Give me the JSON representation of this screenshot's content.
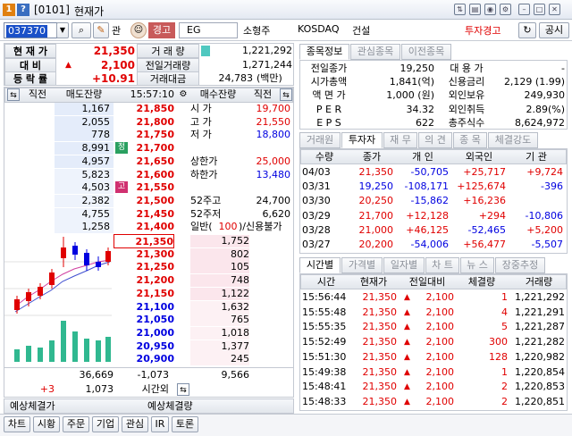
{
  "window": {
    "badge1": "1",
    "badge2": "?",
    "code_title": "[0101]",
    "title": "현재가"
  },
  "toolbar": {
    "code": "037370",
    "kwan": "관",
    "warn": "경고",
    "eg": "EG",
    "company": "소형주",
    "market": "KOSDAQ",
    "sector": "건설",
    "invest_warn": "투자경고",
    "share": "공시"
  },
  "summary": {
    "price_label": "현 재 가",
    "price": "21,350",
    "change_label": "대 비",
    "change_arrow": "▲",
    "change": "2,100",
    "rate_label": "등 락 률",
    "rate": "+10.91",
    "vol_label": "거 래 량",
    "vol": "1,221,292",
    "prev_vol_label": "전일거래량",
    "prev_vol": "1,271,244",
    "amount_label": "거래대금",
    "amount": "24,783",
    "amount_unit": "(백만)"
  },
  "ob": {
    "h_prev": "직전",
    "h_ask": "매도잔량",
    "time": "15:57:10",
    "h_bid": "매수잔량",
    "h_prev2": "직전",
    "asks": [
      {
        "q": "1,167",
        "p": "21,850"
      },
      {
        "q": "2,055",
        "p": "21,800"
      },
      {
        "q": "778",
        "p": "21,750"
      },
      {
        "q": "8,991",
        "p": "21,700",
        "tag": "정"
      },
      {
        "q": "4,957",
        "p": "21,650"
      },
      {
        "q": "5,823",
        "p": "21,600"
      },
      {
        "q": "4,503",
        "p": "21,550",
        "tag": "고"
      },
      {
        "q": "2,382",
        "p": "21,500"
      },
      {
        "q": "4,755",
        "p": "21,450"
      },
      {
        "q": "1,258",
        "p": "21,400"
      }
    ],
    "bids": [
      {
        "p": "21,350",
        "q": "1,752"
      },
      {
        "p": "21,300",
        "q": "802"
      },
      {
        "p": "21,250",
        "q": "105"
      },
      {
        "p": "21,200",
        "q": "748"
      },
      {
        "p": "21,150",
        "q": "1,122"
      },
      {
        "p": "21,100",
        "q": "1,632"
      },
      {
        "p": "21,050",
        "q": "765"
      },
      {
        "p": "21,000",
        "q": "1,018"
      },
      {
        "p": "20,950",
        "q": "1,377"
      },
      {
        "p": "20,900",
        "q": "245"
      }
    ],
    "info": [
      {
        "l": "시 가",
        "v": "19,700",
        "c": "red"
      },
      {
        "l": "고 가",
        "v": "21,550",
        "c": "red"
      },
      {
        "l": "저 가",
        "v": "18,800",
        "c": "blue"
      },
      {
        "l": "",
        "v": ""
      },
      {
        "l": "상한가",
        "v": "25,000",
        "c": "red"
      },
      {
        "l": "하한가",
        "v": "13,480",
        "c": "blue"
      },
      {
        "l": "",
        "v": ""
      },
      {
        "l": "52주고",
        "v": "24,700",
        "c": "blk"
      },
      {
        "l": "52주저",
        "v": "6,620",
        "c": "blk"
      },
      {
        "l": "일반(",
        "v2": "100",
        ")l": ")/신용불가"
      }
    ],
    "total_ask": "36,669",
    "diff": "-1,073",
    "total_bid": "9,566",
    "after_prev": "+3",
    "after_ask": "1,073",
    "after_label": "시간외",
    "exp_price_label": "예상체결가",
    "exp_vol_label": "예상체결량"
  },
  "tabs1": [
    "종목정보",
    "관심종목",
    "이전종목"
  ],
  "info": [
    {
      "l": "전일종가",
      "v": "19,250",
      "l2": "대 용 가",
      "v2": "-"
    },
    {
      "l": "시가총액",
      "v": "1,841(억)",
      "l2": "신용금리",
      "v2": "2,129  (1.99)"
    },
    {
      "l": "액 면 가",
      "v": "1,000 (원)",
      "l2": "외인보유",
      "v2": "249,930"
    },
    {
      "l": "P E R",
      "v": "34.32",
      "l2": "외인취득",
      "v2": "2.89(%)"
    },
    {
      "l": "E P S",
      "v": "622",
      "l2": "총주식수",
      "v2": "8,624,972"
    }
  ],
  "tabs2": [
    "거래원",
    "투자자",
    "재 무",
    "의 견",
    "종 목",
    "체결강도"
  ],
  "inv": {
    "headers": [
      "수량",
      "종가",
      "개 인",
      "외국인",
      "기 관"
    ],
    "rows": [
      [
        "04/03",
        "21,350",
        "-50,705",
        "+25,717",
        "+9,724"
      ],
      [
        "03/31",
        "19,250",
        "-108,171",
        "+125,674",
        "-396"
      ],
      [
        "03/30",
        "20,250",
        "-15,862",
        "+16,236",
        ""
      ],
      [
        "03/29",
        "21,700",
        "+12,128",
        "+294",
        "-10,806"
      ],
      [
        "03/28",
        "21,000",
        "+46,125",
        "-52,465",
        "+5,200"
      ],
      [
        "03/27",
        "20,200",
        "-54,006",
        "+56,477",
        "-5,507"
      ]
    ]
  },
  "tabs3": [
    "시간별",
    "가격별",
    "일자별",
    "차 트",
    "뉴 스",
    "장중추정"
  ],
  "ticks": {
    "headers": [
      "시간",
      "현재가",
      "전일대비",
      "체결량",
      "거래량"
    ],
    "rows": [
      [
        "15:56:44",
        "21,350",
        "2,100",
        "1",
        "1,221,292"
      ],
      [
        "15:55:48",
        "21,350",
        "2,100",
        "4",
        "1,221,291"
      ],
      [
        "15:55:35",
        "21,350",
        "2,100",
        "5",
        "1,221,287"
      ],
      [
        "15:52:49",
        "21,350",
        "2,100",
        "300",
        "1,221,282"
      ],
      [
        "15:51:30",
        "21,350",
        "2,100",
        "128",
        "1,220,982"
      ],
      [
        "15:49:38",
        "21,350",
        "2,100",
        "1",
        "1,220,854"
      ],
      [
        "15:48:41",
        "21,350",
        "2,100",
        "2",
        "1,220,853"
      ],
      [
        "15:48:33",
        "21,350",
        "2,100",
        "2",
        "1,220,851"
      ]
    ]
  },
  "bottom": [
    "차트",
    "시황",
    "주문",
    "기업",
    "관심",
    "IR",
    "토론"
  ],
  "colors": {
    "red": "#e00000",
    "blue": "#0000e0",
    "up": "#e00000"
  }
}
